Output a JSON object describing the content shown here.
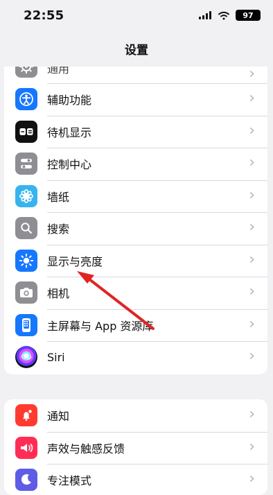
{
  "status_bar": {
    "time": "22:55",
    "battery": "97"
  },
  "nav": {
    "title": "设置"
  },
  "colors": {
    "background": "#f1f1f4",
    "card": "#ffffff",
    "separator": "#d9d9dd",
    "chevron": "#b4b4ba",
    "annotation_arrow": "#e02424"
  },
  "settings_groups": [
    {
      "items": [
        {
          "label": "通用",
          "icon": "gear-icon",
          "partial": true
        },
        {
          "label": "辅助功能",
          "icon": "accessibility-icon"
        },
        {
          "label": "待机显示",
          "icon": "standby-icon"
        },
        {
          "label": "控制中心",
          "icon": "control-center-icon"
        },
        {
          "label": "墙纸",
          "icon": "wallpaper-icon"
        },
        {
          "label": "搜索",
          "icon": "search-icon"
        },
        {
          "label": "显示与亮度",
          "icon": "brightness-icon"
        },
        {
          "label": "相机",
          "icon": "camera-icon"
        },
        {
          "label": "主屏幕与 App 资源库",
          "icon": "home-screen-icon"
        },
        {
          "label": "Siri",
          "icon": "siri-icon"
        }
      ]
    },
    {
      "items": [
        {
          "label": "通知",
          "icon": "notification-icon"
        },
        {
          "label": "声效与触感反馈",
          "icon": "sound-icon"
        },
        {
          "label": "专注模式",
          "icon": "focus-icon"
        }
      ]
    }
  ],
  "chevron_glyph": "›"
}
